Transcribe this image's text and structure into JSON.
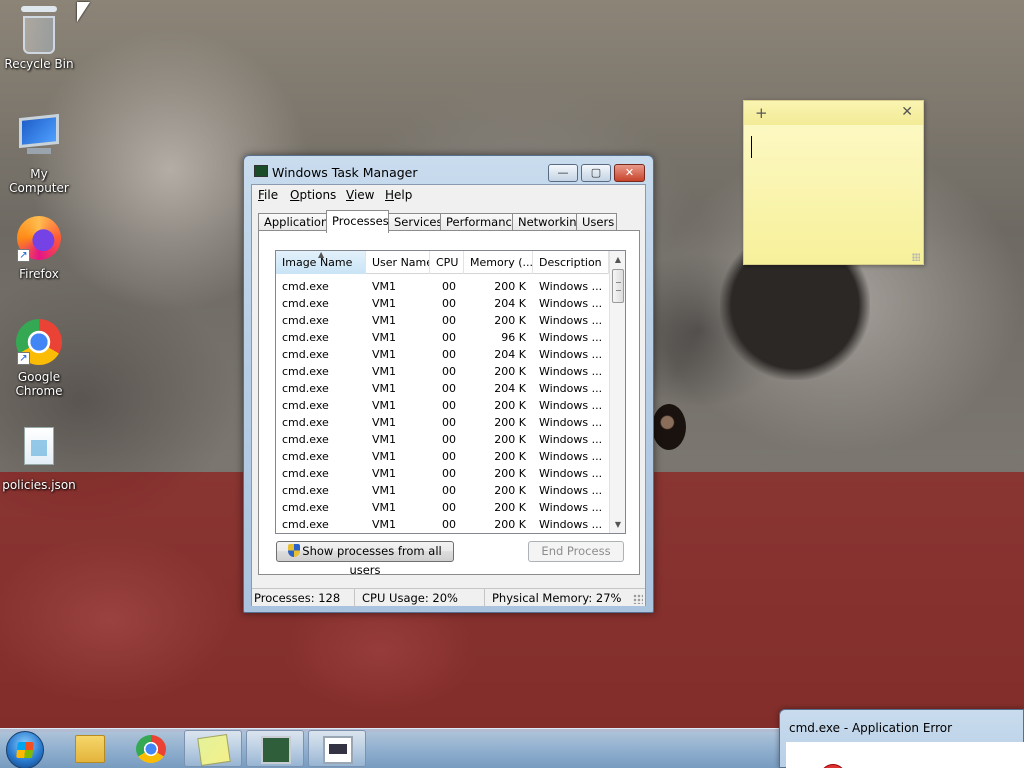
{
  "desktop": {
    "icons": [
      {
        "label": "Recycle Bin",
        "icon": "recycle-bin-icon"
      },
      {
        "label": "My Computer",
        "icon": "computer-icon"
      },
      {
        "label": "Firefox",
        "icon": "firefox-icon"
      },
      {
        "label": "Google Chrome",
        "icon": "chrome-icon"
      },
      {
        "label": "policies.json",
        "icon": "json-file-icon"
      }
    ]
  },
  "task_manager": {
    "title": "Windows Task Manager",
    "window_buttons": {
      "minimize": "—",
      "maximize": "▢",
      "close": "✕"
    },
    "menu": [
      "File",
      "Options",
      "View",
      "Help"
    ],
    "tabs": [
      "Applications",
      "Processes",
      "Services",
      "Performance",
      "Networking",
      "Users"
    ],
    "active_tab": "Processes",
    "columns": [
      "Image Name",
      "User Name",
      "CPU",
      "Memory (...",
      "Description"
    ],
    "sorted_column": "Image Name",
    "rows": [
      {
        "name": "cmd.exe",
        "user": "VM1",
        "cpu": "00",
        "mem": "200 K",
        "desc": "Windows ..."
      },
      {
        "name": "cmd.exe",
        "user": "VM1",
        "cpu": "00",
        "mem": "204 K",
        "desc": "Windows ..."
      },
      {
        "name": "cmd.exe",
        "user": "VM1",
        "cpu": "00",
        "mem": "200 K",
        "desc": "Windows ..."
      },
      {
        "name": "cmd.exe",
        "user": "VM1",
        "cpu": "00",
        "mem": "96 K",
        "desc": "Windows ..."
      },
      {
        "name": "cmd.exe",
        "user": "VM1",
        "cpu": "00",
        "mem": "204 K",
        "desc": "Windows ..."
      },
      {
        "name": "cmd.exe",
        "user": "VM1",
        "cpu": "00",
        "mem": "200 K",
        "desc": "Windows ..."
      },
      {
        "name": "cmd.exe",
        "user": "VM1",
        "cpu": "00",
        "mem": "204 K",
        "desc": "Windows ..."
      },
      {
        "name": "cmd.exe",
        "user": "VM1",
        "cpu": "00",
        "mem": "200 K",
        "desc": "Windows ..."
      },
      {
        "name": "cmd.exe",
        "user": "VM1",
        "cpu": "00",
        "mem": "200 K",
        "desc": "Windows ..."
      },
      {
        "name": "cmd.exe",
        "user": "VM1",
        "cpu": "00",
        "mem": "200 K",
        "desc": "Windows ..."
      },
      {
        "name": "cmd.exe",
        "user": "VM1",
        "cpu": "00",
        "mem": "200 K",
        "desc": "Windows ..."
      },
      {
        "name": "cmd.exe",
        "user": "VM1",
        "cpu": "00",
        "mem": "200 K",
        "desc": "Windows ..."
      },
      {
        "name": "cmd.exe",
        "user": "VM1",
        "cpu": "00",
        "mem": "200 K",
        "desc": "Windows ..."
      },
      {
        "name": "cmd.exe",
        "user": "VM1",
        "cpu": "00",
        "mem": "200 K",
        "desc": "Windows ..."
      },
      {
        "name": "cmd.exe",
        "user": "VM1",
        "cpu": "00",
        "mem": "200 K",
        "desc": "Windows ..."
      }
    ],
    "show_all_button": "Show processes from all users",
    "end_process_button": "End Process",
    "status": {
      "processes": "Processes: 128",
      "cpu": "CPU Usage: 20%",
      "memory": "Physical Memory: 27%"
    }
  },
  "sticky_note": {
    "add": "+",
    "close": "✕",
    "text": ""
  },
  "taskbar": {
    "start": "Start",
    "items": [
      {
        "name": "explorer",
        "icon": "folder-icon",
        "active": false
      },
      {
        "name": "chrome",
        "icon": "chrome-icon",
        "active": false
      },
      {
        "name": "sticky-notes",
        "icon": "sticky-notes-icon",
        "active": true
      },
      {
        "name": "task-manager",
        "icon": "task-manager-icon",
        "active": true
      },
      {
        "name": "cmd",
        "icon": "console-icon",
        "active": true
      }
    ]
  },
  "error_dialog": {
    "title": "cmd.exe - Application Error"
  }
}
